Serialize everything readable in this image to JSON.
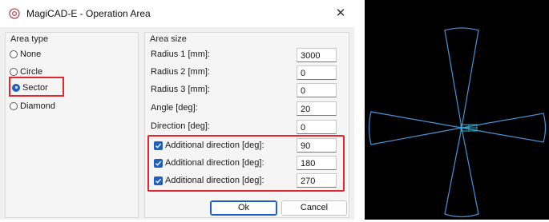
{
  "window": {
    "title": "MagiCAD-E - Operation Area",
    "app_icon": "magicad-logo-icon",
    "close_glyph": "✕"
  },
  "area_type": {
    "title": "Area type",
    "options": [
      {
        "label": "None",
        "selected": false
      },
      {
        "label": "Circle",
        "selected": false
      },
      {
        "label": "Sector",
        "selected": true
      },
      {
        "label": "Diamond",
        "selected": false
      }
    ]
  },
  "area_size": {
    "title": "Area size",
    "fields": [
      {
        "label": "Radius 1 [mm]:",
        "value": "3000"
      },
      {
        "label": "Radius 2 [mm]:",
        "value": "0"
      },
      {
        "label": "Radius 3 [mm]:",
        "value": "0"
      },
      {
        "label": "Angle [deg]:",
        "value": "20"
      },
      {
        "label": "Direction [deg]:",
        "value": "0"
      }
    ],
    "additional": [
      {
        "label": "Additional direction [deg]:",
        "value": "90",
        "checked": true
      },
      {
        "label": "Additional direction [deg]:",
        "value": "180",
        "checked": true
      },
      {
        "label": "Additional direction [deg]:",
        "value": "270",
        "checked": true
      }
    ]
  },
  "buttons": {
    "ok": "Ok",
    "cancel": "Cancel"
  },
  "colors": {
    "accent": "#1f5fbf",
    "highlight": "#e0282e",
    "preview_background": "#000000",
    "sector_outline": "#4a93d6",
    "device_marker": "#26b8c9"
  },
  "preview": {
    "shape": "sector",
    "angle_deg": 20,
    "directions_deg": [
      0,
      90,
      180,
      270
    ]
  }
}
